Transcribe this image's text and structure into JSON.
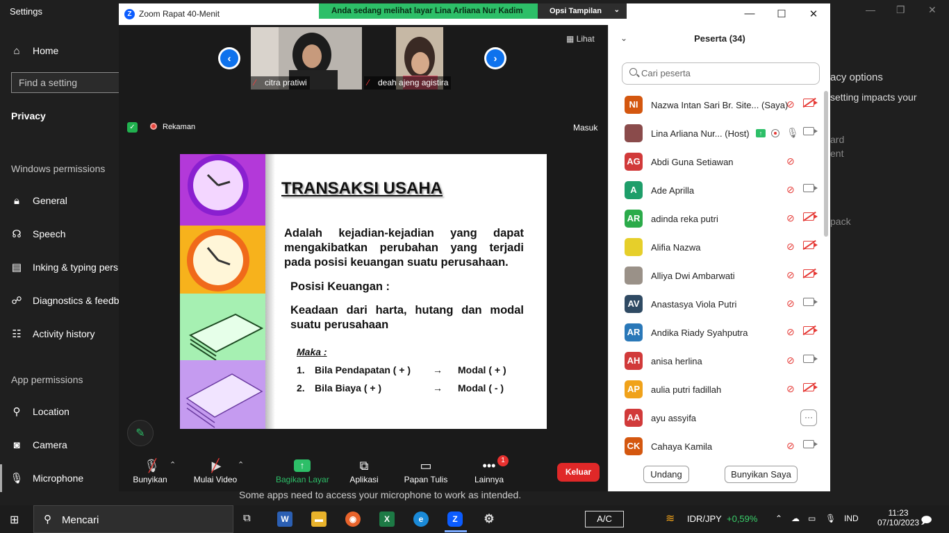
{
  "settings": {
    "title": "Settings",
    "home": "Home",
    "find_placeholder": "Find a setting",
    "privacy": "Privacy",
    "windows_permissions": "Windows permissions",
    "nav_windows": [
      "General",
      "Speech",
      "Inking & typing pers",
      "Diagnostics & feedb",
      "Activity history"
    ],
    "app_permissions": "App permissions",
    "nav_apps": [
      "Location",
      "Camera",
      "Microphone"
    ],
    "right_texts": [
      "acy options",
      "setting impacts your",
      "ard",
      "ent",
      "pack"
    ],
    "bottom_text_1": "Some apps need to access your microphone to work as intended."
  },
  "zoom": {
    "title": "Zoom Rapat 40-Menit",
    "share_banner": "Anda sedang melihat layar Lina Arliana Nur Kadim",
    "view_options": "Opsi Tampilan",
    "lihat": "Lihat",
    "recording": "Rekaman",
    "masuk": "Masuk",
    "videos": [
      {
        "name": "citra pratiwi"
      },
      {
        "name": "deah ajeng agistira"
      }
    ],
    "slide": {
      "title": "TRANSAKSI USAHA",
      "definition": "Adalah kejadian-kejadian yang dapat mengakibatkan perubahan yang terjadi pada posisi keuangan suatu perusahaan.",
      "posisi": "Posisi Keuangan  :",
      "keadaan": "Keadaan dari harta, hutang dan modal suatu perusahaan",
      "maka": "Maka",
      "maka_colon": " :",
      "rows": [
        {
          "num": "1.",
          "text": "Bila Pendapatan ( + )",
          "arrow": "→",
          "result": "Modal ( + )"
        },
        {
          "num": "2.",
          "text": "Bila Biaya ( + )",
          "arrow": "→",
          "result": "Modal ( - )"
        }
      ]
    },
    "toolbar": {
      "mute": "Bunyikan",
      "video": "Mulai Video",
      "share": "Bagikan Layar",
      "apps": "Aplikasi",
      "whiteboard": "Papan Tulis",
      "more": "Lainnya",
      "more_badge": "1",
      "leave": "Keluar"
    },
    "participants": {
      "header": "Peserta (34)",
      "search_placeholder": "Cari peserta",
      "invite": "Undang",
      "unmute_me": "Bunyikan Saya",
      "list": [
        {
          "initials": "NI",
          "name": "Nazwa Intan Sari Br. Site...",
          "suffix": "(Saya)",
          "color": "#d4570f",
          "mic": "off",
          "cam": "off"
        },
        {
          "initials": "",
          "name": "Lina Arliana Nur...",
          "suffix": "(Host)",
          "color": "#8a4b4b",
          "mic": "on",
          "cam": "on"
        },
        {
          "initials": "AG",
          "name": "Abdi Guna Setiawan",
          "suffix": "",
          "color": "#d13a3a",
          "mic": "off",
          "cam": "none"
        },
        {
          "initials": "A",
          "name": "Ade Aprilla",
          "suffix": "",
          "color": "#1e9e6a",
          "mic": "off",
          "cam": "on"
        },
        {
          "initials": "AR",
          "name": "adinda reka putri",
          "suffix": "",
          "color": "#2bab4a",
          "mic": "off",
          "cam": "off"
        },
        {
          "initials": "",
          "name": "Alifia Nazwa",
          "suffix": "",
          "color": "#e6cf2a",
          "mic": "off",
          "cam": "off"
        },
        {
          "initials": "",
          "name": "Alliya Dwi Ambarwati",
          "suffix": "",
          "color": "#9a9188",
          "mic": "off",
          "cam": "off"
        },
        {
          "initials": "AV",
          "name": "Anastasya Viola Putri",
          "suffix": "",
          "color": "#2f4a63",
          "mic": "off",
          "cam": "on"
        },
        {
          "initials": "AR",
          "name": "Andika Riady Syahputra",
          "suffix": "",
          "color": "#2a78b8",
          "mic": "off",
          "cam": "off"
        },
        {
          "initials": "AH",
          "name": "anisa herlina",
          "suffix": "",
          "color": "#d13a3a",
          "mic": "off",
          "cam": "on"
        },
        {
          "initials": "AP",
          "name": "aulia putri fadillah",
          "suffix": "",
          "color": "#f0a21a",
          "mic": "off",
          "cam": "off"
        },
        {
          "initials": "AA",
          "name": "ayu assyifa",
          "suffix": "",
          "color": "#d13a3a",
          "mic": "more",
          "cam": "none"
        },
        {
          "initials": "CK",
          "name": "Cahaya Kamila",
          "suffix": "",
          "color": "#d4570f",
          "mic": "off",
          "cam": "on"
        }
      ]
    }
  },
  "taskbar": {
    "search": "Mencari",
    "ac": "A/C",
    "ticker": "IDR/JPY",
    "ticker_change": "+0,59%",
    "lang": "IND",
    "time": "11:23",
    "date": "07/10/2023"
  }
}
